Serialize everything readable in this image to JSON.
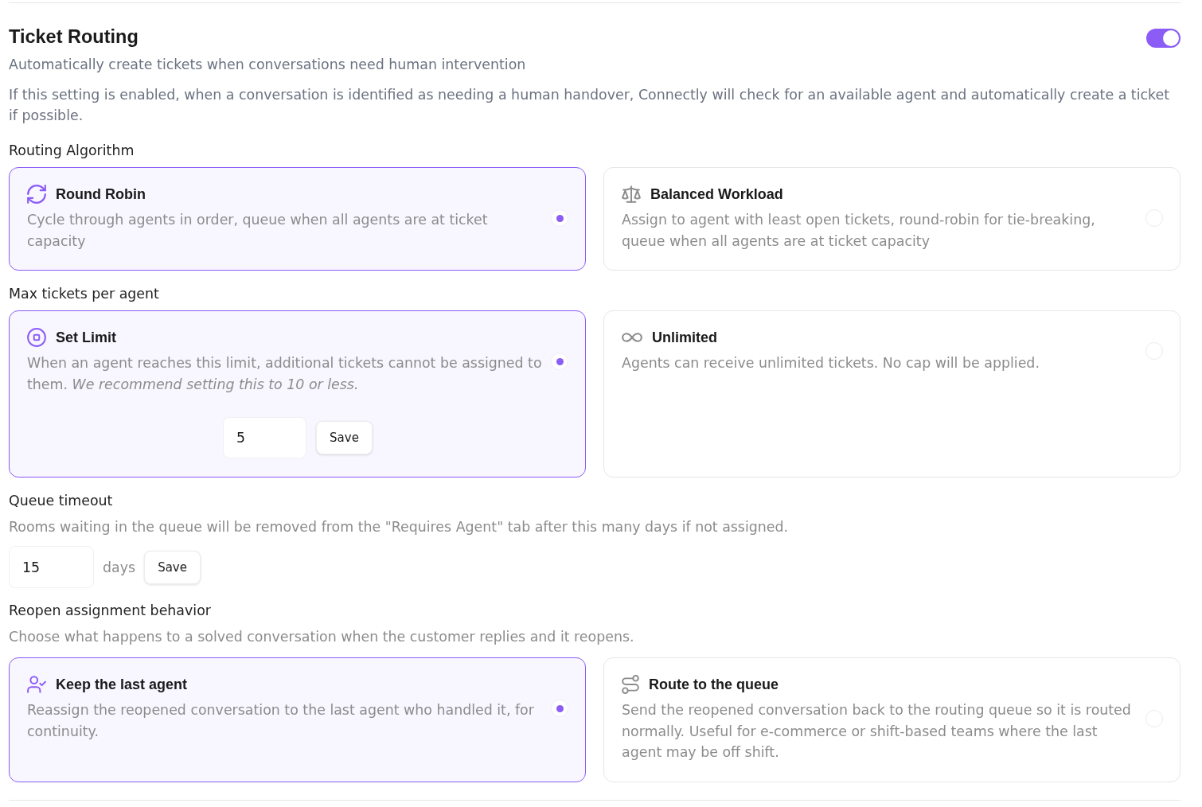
{
  "header": {
    "title": "Ticket Routing",
    "enabled": true,
    "subtitle": "Automatically create tickets when conversations need human intervention",
    "description": "If this setting is enabled, when a conversation is identified as needing a human handover, Connectly will check for an available agent and automatically create a ticket if possible."
  },
  "sections": [
    {
      "label": "Routing Algorithm",
      "options": [
        {
          "kind": "cycle",
          "title": "Round Robin",
          "description": "Cycle through agents in order, queue when all agents are at ticket capacity",
          "selected": true
        },
        {
          "kind": "balance",
          "title": "Balanced Workload",
          "description": "Assign to agent with least open tickets, round-robin for tie-breaking, queue when all agents are at ticket capacity",
          "selected": false
        }
      ]
    },
    {
      "label": "Max tickets per agent",
      "options": [
        {
          "kind": "limit",
          "title": "Set Limit",
          "description": "When an agent reaches this limit, additional tickets cannot be assigned to them. *We recommend setting this to 10 or less.*",
          "selected": true,
          "field": {
            "value": "5"
          },
          "button": "Save"
        },
        {
          "kind": "unlimited",
          "title": "Unlimited",
          "description": "Agents can receive unlimited tickets. No cap will be applied.",
          "selected": false
        }
      ]
    },
    {
      "label": "Queue timeout",
      "description": "Rooms waiting in the queue will be removed from the \"Requires Agent\" tab after this many days if not assigned.",
      "field": {
        "value": "15"
      },
      "unit": "days",
      "button": "Save"
    },
    {
      "label": "Reopen assignment behavior",
      "description": "Choose what happens to a solved conversation when the customer replies and it reopens.",
      "options": [
        {
          "kind": "keep",
          "title": "Keep the last agent",
          "description": "Reassign the reopened conversation to the last agent who handled it, for continuity.",
          "selected": true
        },
        {
          "kind": "queue",
          "title": "Route to the queue",
          "description": "Send the reopened conversation back to the routing queue so it is routed normally. Useful for e-commerce or shift-based teams where the last agent may be off shift.",
          "selected": false
        }
      ]
    }
  ]
}
